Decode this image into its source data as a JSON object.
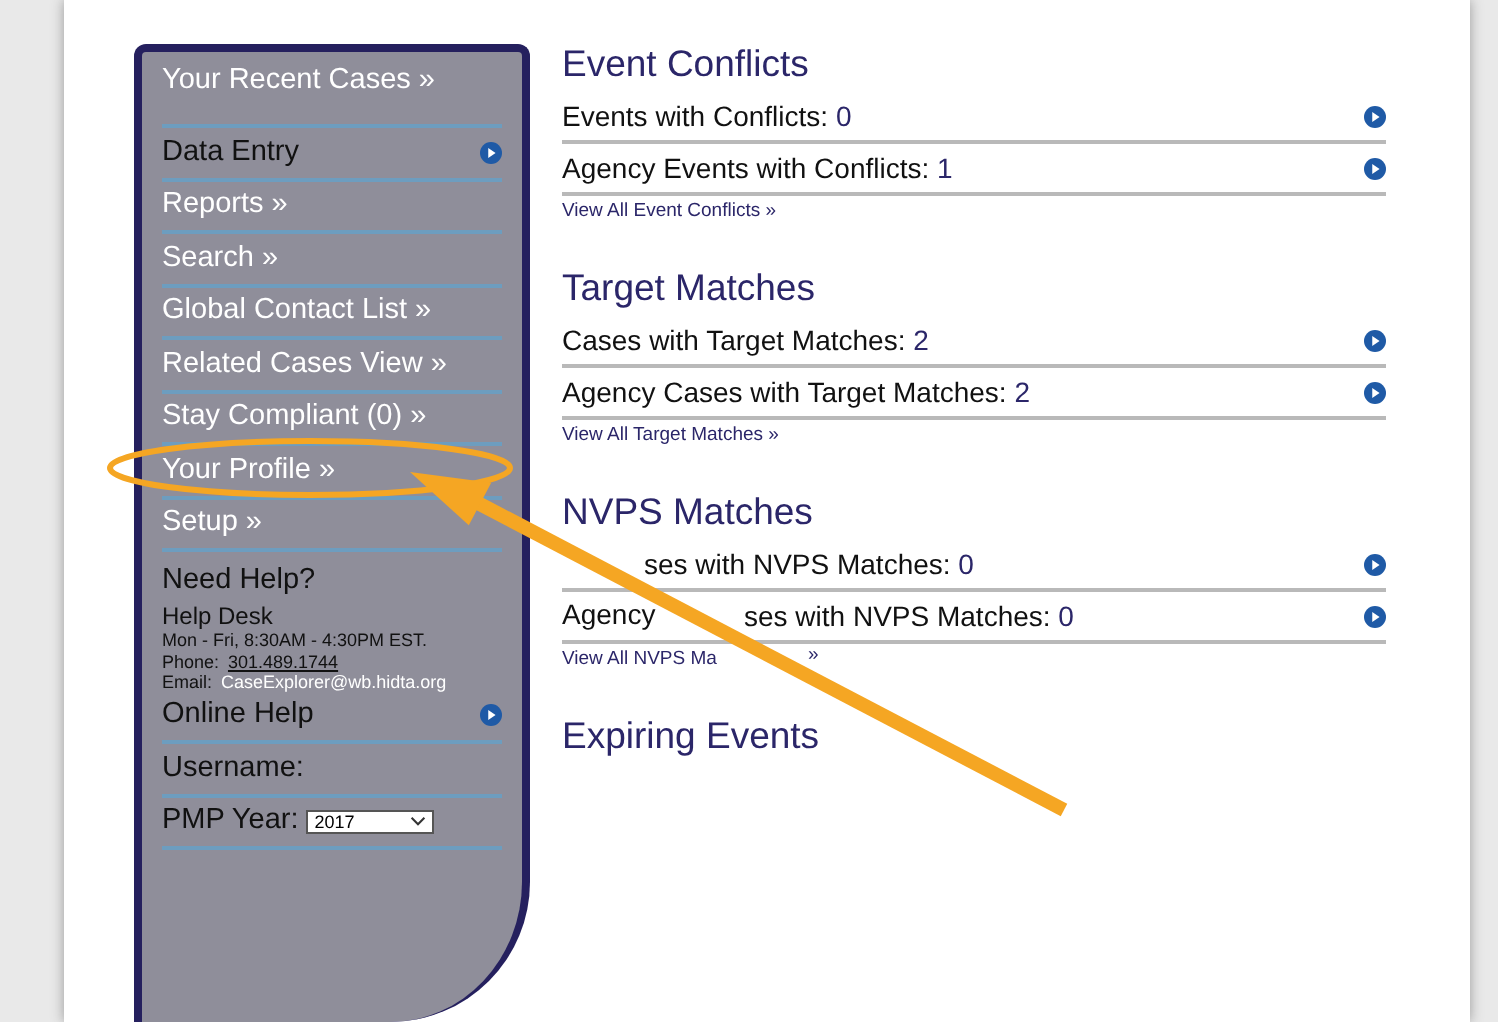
{
  "sidebar": {
    "recent": "Your Recent Cases »",
    "items": [
      {
        "label": "Data Entry",
        "kind": "icon"
      },
      {
        "label": "Reports »",
        "kind": "link"
      },
      {
        "label": "Search »",
        "kind": "link"
      },
      {
        "label": "Global Contact List »",
        "kind": "link"
      },
      {
        "label": "Related Cases View »",
        "kind": "link"
      },
      {
        "label": "Stay Compliant (0) »",
        "kind": "link"
      },
      {
        "label": "Your Profile »",
        "kind": "link"
      },
      {
        "label": "Setup »",
        "kind": "link"
      }
    ],
    "help": {
      "title": "Need Help?",
      "desk": "Help Desk",
      "hours": "Mon - Fri, 8:30AM - 4:30PM EST.",
      "phone_label": "Phone:",
      "phone": "301.489.1744",
      "email_label": "Email:",
      "email": "CaseExplorer@wb.hidta.org",
      "online": "Online Help"
    },
    "username": "Username:",
    "pmp": {
      "label": "PMP Year:",
      "value": "2017"
    }
  },
  "sections": [
    {
      "title": "Event Conflicts",
      "rows": [
        {
          "kind": "plain",
          "label": "Events with Conflicts:",
          "count": "0"
        },
        {
          "kind": "plain",
          "label": "Agency Events with Conflicts:",
          "count": "1"
        }
      ],
      "link": "View All Event Conflicts »"
    },
    {
      "title": "Target Matches",
      "rows": [
        {
          "kind": "plain",
          "label": "Cases with Target Matches:",
          "count": "2"
        },
        {
          "kind": "plain",
          "label": "Agency Cases with Target Matches:",
          "count": "2"
        }
      ],
      "link": "View All Target Matches »"
    },
    {
      "title": "NVPS Matches",
      "rows": [
        {
          "kind": "cut",
          "label": "ses with NVPS Matches:",
          "count": "0"
        },
        {
          "kind": "cut",
          "lead": "Agency",
          "label": "ses with NVPS Matches:",
          "count": "0"
        }
      ],
      "link": "View All NVPS Ma",
      "link_tail": "»"
    },
    {
      "title": "Expiring Events"
    }
  ]
}
